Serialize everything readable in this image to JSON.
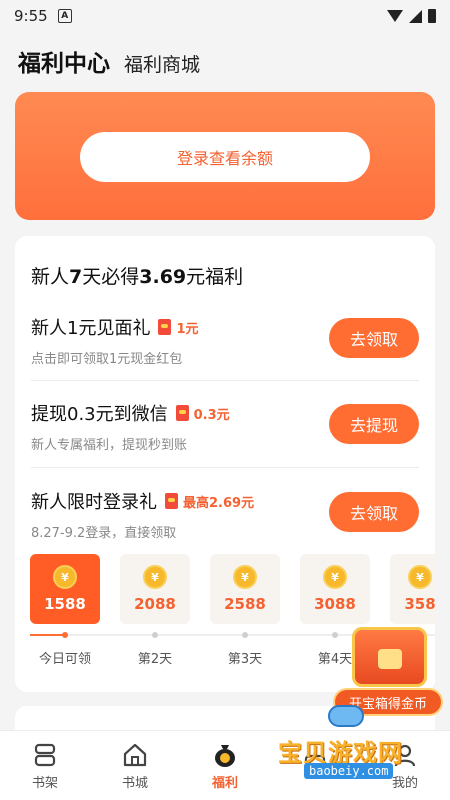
{
  "status": {
    "time": "9:55",
    "notif": "A"
  },
  "header": {
    "title": "福利中心",
    "subtitle": "福利商城"
  },
  "login": {
    "button": "登录查看余额"
  },
  "welfare": {
    "title_pre": "新人",
    "title_bold1": "7",
    "title_mid": "天必得",
    "title_bold2": "3.69",
    "title_post": "元福利",
    "tasks": [
      {
        "name": "新人1元见面礼",
        "reward": "1元",
        "desc": "点击即可领取1元现金红包",
        "button": "去领取"
      },
      {
        "name": "提现0.3元到微信",
        "reward": "0.3元",
        "desc": "新人专属福利，提现秒到账",
        "button": "去提现"
      },
      {
        "name": "新人限时登录礼",
        "reward": "最高2.69元",
        "desc": "8.27-9.2登录，直接领取",
        "button": "去领取"
      }
    ],
    "days": [
      {
        "amount": "1588",
        "label": "今日可领",
        "active": true
      },
      {
        "amount": "2088",
        "label": "第2天"
      },
      {
        "amount": "2588",
        "label": "第3天"
      },
      {
        "amount": "3088",
        "label": "第4天"
      },
      {
        "amount": "358",
        "label": ""
      }
    ],
    "coin_symbol": "¥"
  },
  "treasure": {
    "label": "开宝箱得金币"
  },
  "nav": [
    {
      "label": "书架",
      "icon": "bookshelf-icon"
    },
    {
      "label": "书城",
      "icon": "home-icon"
    },
    {
      "label": "福利",
      "icon": "money-bag-icon",
      "active": true
    },
    {
      "label": "",
      "icon": "store-icon"
    },
    {
      "label": "我的",
      "icon": "user-icon"
    }
  ],
  "watermark": {
    "title": "宝贝游戏网",
    "url": "baobeiy.com"
  },
  "colors": {
    "accent": "#ff6d33",
    "accent_text": "#f46231"
  }
}
